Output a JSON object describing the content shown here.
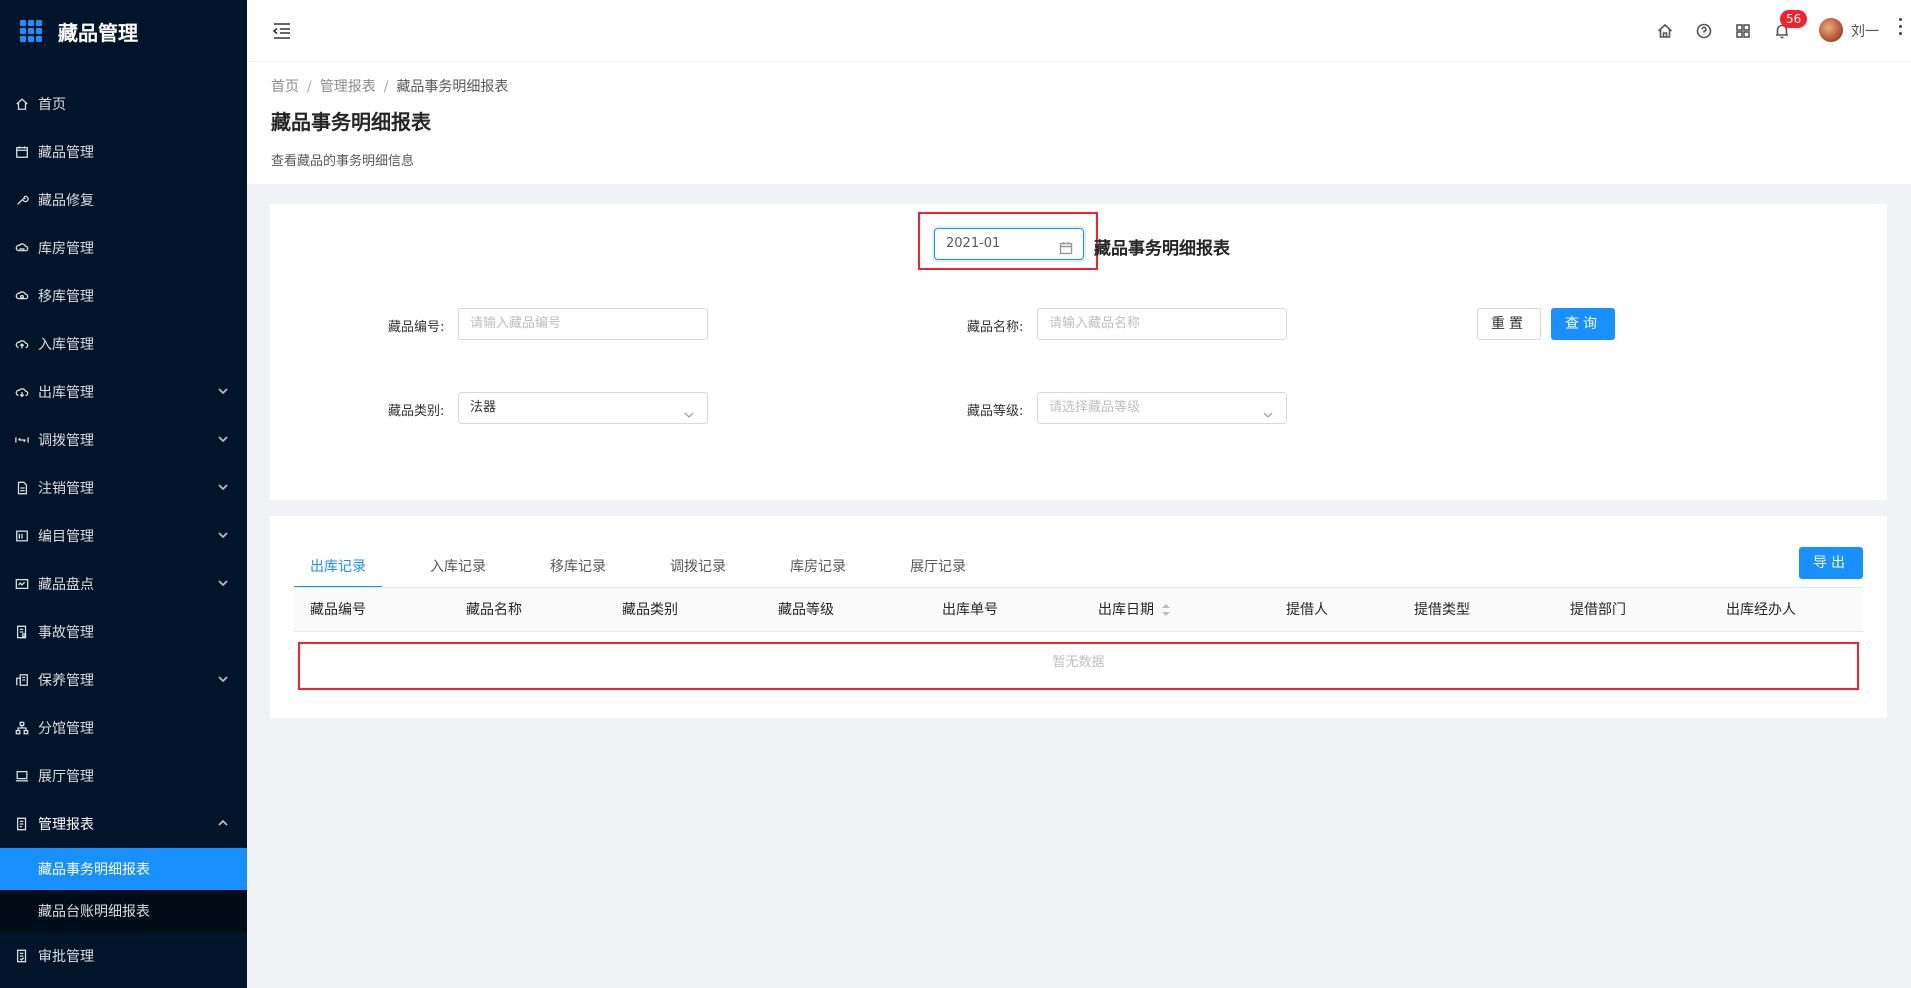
{
  "app": {
    "title": "藏品管理"
  },
  "colors": {
    "accent": "#1890ff",
    "sidebar_bg": "#001529",
    "highlight": "#f5222d",
    "badge": "#f5222d"
  },
  "sidebar": {
    "items": [
      {
        "label": "首页",
        "icon": "home-icon"
      },
      {
        "label": "藏品管理",
        "icon": "calendar-icon"
      },
      {
        "label": "藏品修复",
        "icon": "wrench-icon"
      },
      {
        "label": "库房管理",
        "icon": "warehouse-icon"
      },
      {
        "label": "移库管理",
        "icon": "transfer-icon"
      },
      {
        "label": "入库管理",
        "icon": "upload-cloud-icon"
      },
      {
        "label": "出库管理",
        "icon": "download-cloud-icon"
      },
      {
        "label": "调拨管理",
        "icon": "swap-icon"
      },
      {
        "label": "注销管理",
        "icon": "file-icon"
      },
      {
        "label": "编目管理",
        "icon": "catalog-icon"
      },
      {
        "label": "藏品盘点",
        "icon": "inventory-icon"
      },
      {
        "label": "事故管理",
        "icon": "incident-icon"
      },
      {
        "label": "保养管理",
        "icon": "maintenance-icon"
      },
      {
        "label": "分馆管理",
        "icon": "branch-icon"
      },
      {
        "label": "展厅管理",
        "icon": "hall-icon"
      },
      {
        "label": "管理报表",
        "icon": "report-icon"
      },
      {
        "label": "藏品事务明细报表"
      },
      {
        "label": "藏品台账明细报表"
      },
      {
        "label": "审批管理",
        "icon": "approval-icon"
      }
    ]
  },
  "header": {
    "notification_count": "56",
    "user_name": "刘一"
  },
  "page": {
    "breadcrumb": [
      "首页",
      "管理报表",
      "藏品事务明细报表"
    ],
    "separator": "/",
    "title": "藏品事务明细报表",
    "description": "查看藏品的事务明细信息"
  },
  "filter": {
    "date_value": "2021-01",
    "report_title": "藏品事务明细报表",
    "code_label": "藏品编号:",
    "code_placeholder": "请输入藏品编号",
    "name_label": "藏品名称:",
    "name_placeholder": "请输入藏品名称",
    "category_label": "藏品类别:",
    "category_value": "法器",
    "level_label": "藏品等级:",
    "level_placeholder": "请选择藏品等级",
    "reset_label": "重置",
    "query_label": "查询"
  },
  "records": {
    "tabs": [
      "出库记录",
      "入库记录",
      "移库记录",
      "调拨记录",
      "库房记录",
      "展厅记录"
    ],
    "active_tab": "出库记录",
    "export_label": "导出",
    "columns": [
      "藏品编号",
      "藏品名称",
      "藏品类别",
      "藏品等级",
      "出库单号",
      "出库日期",
      "提借人",
      "提借类型",
      "提借部门",
      "出库经办人"
    ],
    "empty_text": "暂无数据"
  }
}
